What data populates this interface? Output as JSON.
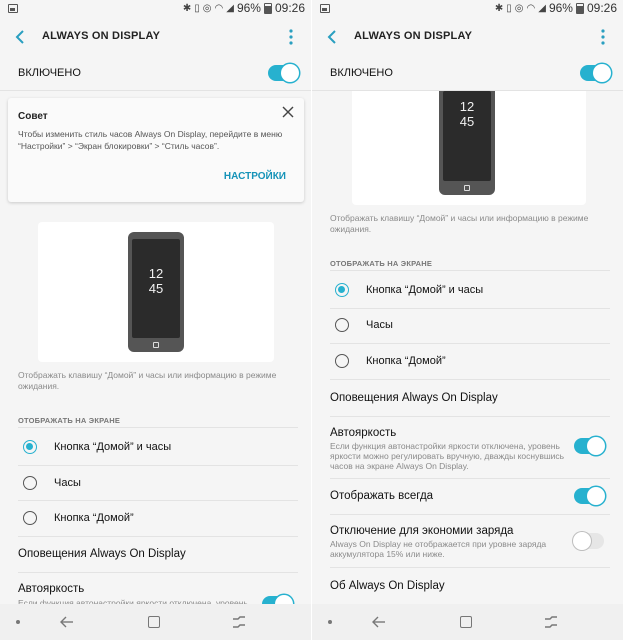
{
  "status_bar": {
    "battery": "96%",
    "time": "09:26"
  },
  "app_bar": {
    "title": "ALWAYS ON DISPLAY"
  },
  "master": {
    "label": "ВКЛЮЧЕНО",
    "on": true
  },
  "tip": {
    "title": "Совет",
    "text": "Чтобы изменить стиль часов Always On Display, перейдите в меню “Настройки” > “Экран блокировки” > “Стиль часов”.",
    "action": "НАСТРОЙКИ"
  },
  "preview": {
    "clock_hour": "12",
    "clock_minute": "45"
  },
  "description": "Отображать клавишу “Домой” и часы или информацию в режиме ожидания.",
  "display_section": {
    "header": "ОТОБРАЖАТЬ НА ЭКРАНЕ",
    "options": [
      {
        "label": "Кнопка “Домой” и часы",
        "selected": true
      },
      {
        "label": "Часы",
        "selected": false
      },
      {
        "label": "Кнопка “Домой”",
        "selected": false
      }
    ]
  },
  "notifications": {
    "label": "Оповещения Always On Display"
  },
  "auto_brightness": {
    "label": "Автояркость",
    "sub": "Если функция автонастройки яркости отключена, уровень яркости можно регулировать вручную, дважды коснувшись часов на экране Always On Display.",
    "sub_left_clip": "Если функция автонастройки яркости отключена, уровень",
    "on": true
  },
  "always_show": {
    "label": "Отображать всегда",
    "on": true
  },
  "power_saving": {
    "label": "Отключение для экономии заряда",
    "sub": "Always On Display не отображается при уровне заряда аккумулятора 15% или ниже.",
    "on": false
  },
  "about": {
    "label": "Об Always On Display"
  },
  "colors": {
    "accent": "#27b1cf",
    "action": "#1593b8",
    "background": "#f5f5f5"
  }
}
